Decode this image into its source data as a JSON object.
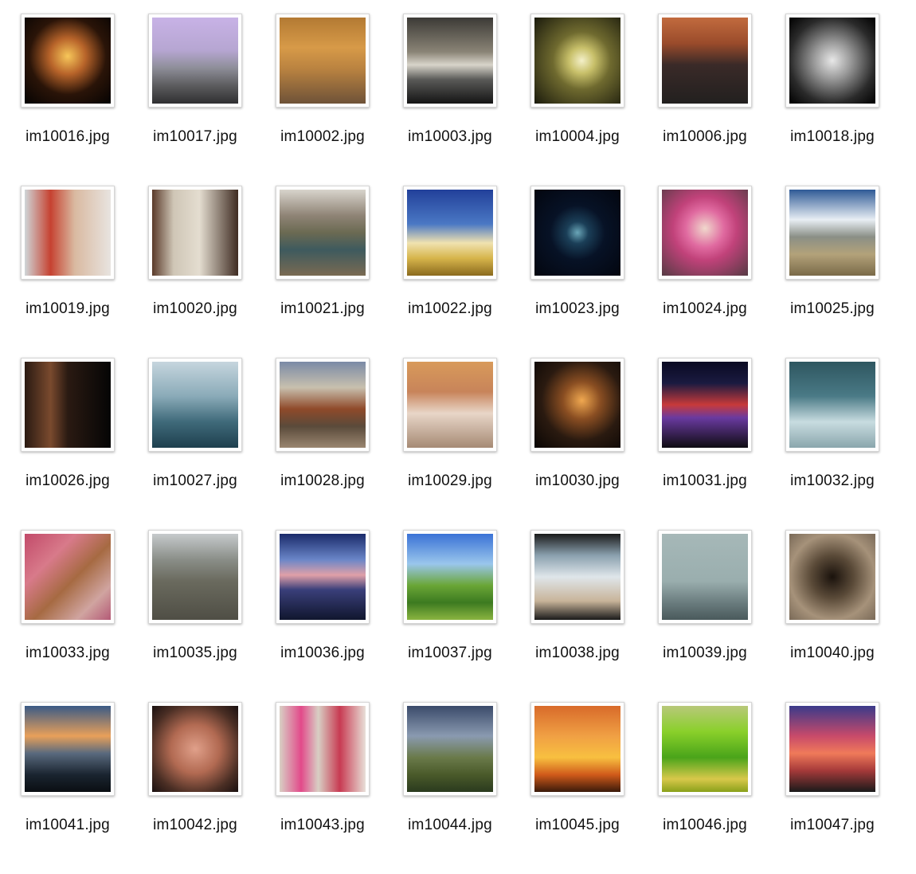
{
  "files": [
    {
      "name": "im10016.jpg",
      "bg": "radial-gradient(circle at 50% 45%, #f7c75a 0%, #b8642a 28%, #2a1408 60%, #050302 100%)"
    },
    {
      "name": "im10017.jpg",
      "bg": "linear-gradient(180deg, #c8b2e6 0%, #b6a6d2 38%, #8f8f9a 58%, #5a5a5c 80%, #2f2f31 100%)"
    },
    {
      "name": "im10002.jpg",
      "bg": "linear-gradient(180deg, #b37a33 0%, #d79a48 35%, #b98240 60%, #6e5238 100%)"
    },
    {
      "name": "im10003.jpg",
      "bg": "linear-gradient(180deg, #3c3a36 0%, #8a8476 40%, #d8d4ca 55%, #5a5a58 72%, #141414 100%)"
    },
    {
      "name": "im10004.jpg",
      "bg": "radial-gradient(circle at 55% 50%, #f4f0c9 0%, #c8c06a 20%, #6f6a2f 45%, #1a1a0c 100%)"
    },
    {
      "name": "im10006.jpg",
      "bg": "linear-gradient(180deg, #c26b3e 0%, #9a4b2b 30%, #3a2a28 55%, #22201f 100%)"
    },
    {
      "name": "im10018.jpg",
      "bg": "radial-gradient(circle at 50% 50%, #e8e8e8 0%, #9a9a9a 30%, #2a2a2a 70%, #000000 100%)"
    },
    {
      "name": "im10019.jpg",
      "bg": "linear-gradient(90deg, #cfd6d8 0%, #c64231 30%, #d9b9a0 58%, #e8e4e0 100%)"
    },
    {
      "name": "im10020.jpg",
      "bg": "linear-gradient(90deg, #5a3a2a 0%, #cfc6b6 25%, #e4ddd0 55%, #3f2c22 100%)"
    },
    {
      "name": "im10021.jpg",
      "bg": "linear-gradient(180deg, #d8d4cc 0%, #8f8476 30%, #6b6a52 50%, #3e5a5e 70%, #7a6a52 100%)"
    },
    {
      "name": "im10022.jpg",
      "bg": "linear-gradient(180deg, #22409a 0%, #4a78c4 40%, #f0e2b0 62%, #d6b44a 80%, #8a6a1e 100%)"
    },
    {
      "name": "im10023.jpg",
      "bg": "radial-gradient(circle at 50% 50%, #6aa6b8 0%, #1b3f58 18%, #071226 45%, #03060f 100%)"
    },
    {
      "name": "im10024.jpg",
      "bg": "radial-gradient(circle at 50% 45%, #f0d8cc 0%, #e06aa0 30%, #c1427a 50%, #563b44 100%)"
    },
    {
      "name": "im10025.jpg",
      "bg": "linear-gradient(180deg, #2f5a96 0%, #e8eef4 35%, #8a8f86 55%, #b3a27a 75%, #7a6a48 100%)"
    },
    {
      "name": "im10026.jpg",
      "bg": "linear-gradient(90deg, #2a1a12 0%, #7a4a2e 30%, #2a1a12 50%, #050505 100%)"
    },
    {
      "name": "im10027.jpg",
      "bg": "linear-gradient(180deg, #c6d6de 0%, #8aaab8 40%, #3f6a7a 70%, #1e3f4e 100%)"
    },
    {
      "name": "im10028.jpg",
      "bg": "linear-gradient(180deg, #7a8aa6 0%, #c8c0ae 30%, #8f4a2a 55%, #5a4a3a 75%, #9a8670 100%)"
    },
    {
      "name": "im10029.jpg",
      "bg": "linear-gradient(180deg, #d89a5a 0%, #c8845a 35%, #e8d6c8 60%, #a68a74 100%)"
    },
    {
      "name": "im10030.jpg",
      "bg": "radial-gradient(circle at 55% 45%, #f0a850 0%, #8a4e22 28%, #2a1a10 60%, #0a0604 100%)"
    },
    {
      "name": "im10031.jpg",
      "bg": "linear-gradient(180deg, #0a0a22 0%, #1a1a40 25%, #c83a3a 50%, #6a3aa0 65%, #0e0c12 100%)"
    },
    {
      "name": "im10032.jpg",
      "bg": "linear-gradient(180deg, #2e5660 0%, #4a7a86 40%, #c8dce0 70%, #8aa6ac 100%)"
    },
    {
      "name": "im10033.jpg",
      "bg": "linear-gradient(135deg, #c24a6a 0%, #d87a8a 30%, #a66a42 55%, #d0a4a0 80%, #b45a76 100%)"
    },
    {
      "name": "im10035.jpg",
      "bg": "linear-gradient(180deg, #c6cacc 0%, #8a8e88 30%, #6a6a5e 55%, #4f4e45 100%)"
    },
    {
      "name": "im10036.jpg",
      "bg": "linear-gradient(180deg, #1a2a6a 0%, #6a86c8 30%, #e0a0a8 48%, #3a3f7a 65%, #10162e 100%)"
    },
    {
      "name": "im10037.jpg",
      "bg": "linear-gradient(180deg, #3a72d6 0%, #9ac6ec 35%, #6aa636 60%, #3c7a20 80%, #8ab440 100%)"
    },
    {
      "name": "im10038.jpg",
      "bg": "linear-gradient(180deg, #1a1a1a 0%, #8aa0ae 25%, #dfe6ea 50%, #c8b49a 78%, #1a1a1a 100%)"
    },
    {
      "name": "im10039.jpg",
      "bg": "linear-gradient(180deg, #a6b8b8 0%, #9aaeae 55%, #6a7c7e 80%, #4a5a5c 100%)"
    },
    {
      "name": "im10040.jpg",
      "bg": "radial-gradient(circle at 50% 50%, #1a120c 0%, #5a4a38 35%, #a6927a 70%, #7a6a58 100%)"
    },
    {
      "name": "im10041.jpg",
      "bg": "linear-gradient(180deg, #3a5a86 0%, #e8a05a 35%, #5a6a7e 55%, #1a2430 80%, #0a0e12 100%)"
    },
    {
      "name": "im10042.jpg",
      "bg": "radial-gradient(circle at 50% 50%, #e0a08a 0%, #b26a52 40%, #4a2e24 75%, #1a1010 100%)"
    },
    {
      "name": "im10043.jpg",
      "bg": "linear-gradient(90deg, #d8cfc4 0%, #e24a8a 25%, #d8cfc4 45%, #c83a52 70%, #e8e0d8 100%)"
    },
    {
      "name": "im10044.jpg",
      "bg": "linear-gradient(180deg, #3a4a6a 0%, #8a9ab0 35%, #6a7a4a 60%, #4a5a2a 80%, #2a3a1e 100%)"
    },
    {
      "name": "im10045.jpg",
      "bg": "linear-gradient(180deg, #d86a2a 0%, #f0a044 35%, #f8c040 60%, #d05a1a 80%, #3a1a0a 100%)"
    },
    {
      "name": "im10046.jpg",
      "bg": "linear-gradient(180deg, #b8c87a 0%, #8ad02a 30%, #4aa41a 60%, #d8c84a 85%, #8aa01a 100%)"
    },
    {
      "name": "im10047.jpg",
      "bg": "linear-gradient(180deg, #3a3a8a 0%, #c84a6a 35%, #f07a5a 55%, #a63a3a 75%, #1a1a1a 100%)"
    }
  ]
}
